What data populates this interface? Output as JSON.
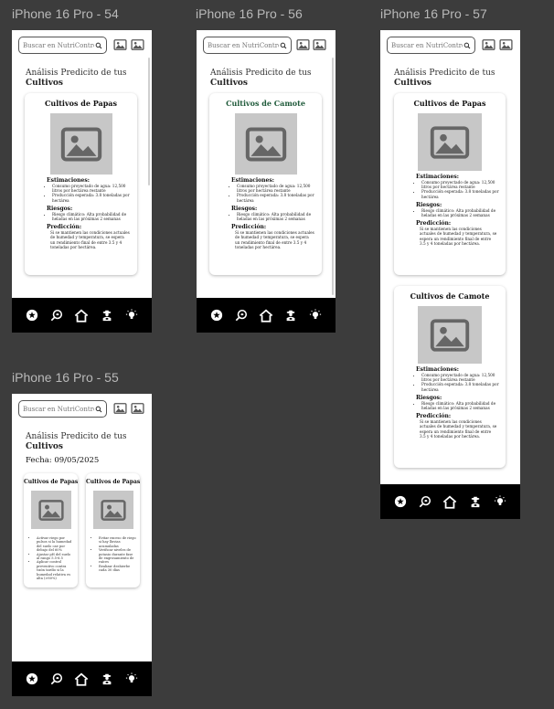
{
  "frames": [
    {
      "title": "iPhone 16 Pro - 54"
    },
    {
      "title": "iPhone 16 Pro - 56"
    },
    {
      "title": "iPhone 16 Pro - 57"
    },
    {
      "title": "iPhone 16 Pro - 55"
    }
  ],
  "search": {
    "placeholder": "Buscar en NutriControl"
  },
  "page": {
    "title_line1": "Análisis Predicito de tus",
    "title_line2": "Cultivos",
    "date": "Fecha: 09/05/2025"
  },
  "labels": {
    "estimaciones": "Estimaciones:",
    "riesgos": "Riesgos:",
    "prediccion": "Predicción:"
  },
  "cards": {
    "papas": {
      "title": "Cultivos de Papas",
      "est": [
        "Consumo proyectado de agua: 12,500 litros por hectárea restante",
        "Producción esperada: 3.8 toneladas por hectárea"
      ],
      "riesgo": [
        "Riesgo climático: Alta probabilidad de heladas en las próximas 2 semanas"
      ],
      "prediccion": "Si se mantienen las condiciones actuales de humedad y temperatura, se espera un rendimiento final de entre 3.5 y 4 toneladas por hectárea."
    },
    "camote": {
      "title": "Cultivos de Camote",
      "est": [
        "Consumo proyectado de agua: 12,500 litros por hectárea restante",
        "Producción esperada: 3.8 toneladas por hectárea"
      ],
      "riesgo": [
        "Riesgo climático: Alta probabilidad de heladas en las próximas 2 semanas"
      ],
      "prediccion": "Si se mantienen las condiciones actuales de humedad y temperatura, se espera un rendimiento final de entre 3.5 y 4 toneladas por hectárea."
    }
  },
  "mini_cards": [
    {
      "title": "Cultivos de Papas",
      "items": [
        "Activar riego por pulsos si la humedad del suelo cae por debajo del 60%",
        "Ajustar pH del suelo al rango 5.5-6.5",
        "Aplicar control preventivo contra tizón tardío si la humedad relativa es alta (>80%)"
      ]
    },
    {
      "title": "Cultivos de Papas",
      "items": [
        "Evitar exceso de riego si hay lluvias acumuladas",
        "Verificar niveles de potasio durante fase de engrosamiento de raíces",
        "Realizar deshierbe cada 30 días"
      ]
    }
  ],
  "nav": [
    {
      "name": "star-icon"
    },
    {
      "name": "search-leaf-icon"
    },
    {
      "name": "home-icon"
    },
    {
      "name": "farmer-icon"
    },
    {
      "name": "lightbulb-icon"
    }
  ]
}
